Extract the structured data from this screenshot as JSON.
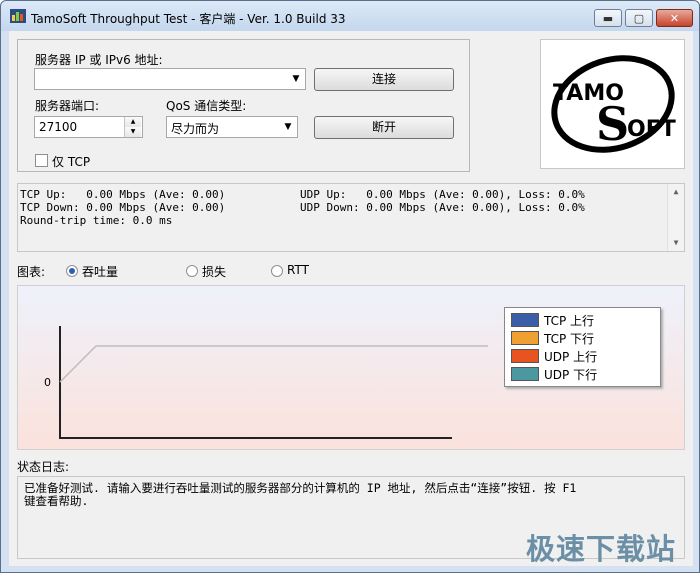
{
  "window": {
    "title": "TamoSoft Throughput Test - 客户端 - Ver. 1.0 Build 33",
    "buttons": {
      "minimize": "▬",
      "maximize": "▢",
      "close": "✕"
    }
  },
  "connection": {
    "server_label": "服务器 IP 或 IPv6 地址:",
    "server_value": "",
    "port_label": "服务器端口:",
    "port_value": "27100",
    "qos_label": "QoS 通信类型:",
    "qos_value": "尽力而为",
    "tcp_only_label": "仅 TCP",
    "connect_button": "连接",
    "disconnect_button": "断开"
  },
  "logo": {
    "text_top": "TAMO",
    "text_bottom": "OFT",
    "letter_s": "S"
  },
  "stats": {
    "tcp_up": "TCP Up:   0.00 Mbps (Ave: 0.00)",
    "tcp_down": "TCP Down: 0.00 Mbps (Ave: 0.00)",
    "udp_up": "UDP Up:   0.00 Mbps (Ave: 0.00), Loss: 0.0%",
    "udp_down": "UDP Down: 0.00 Mbps (Ave: 0.00), Loss: 0.0%",
    "rtt": "Round-trip time: 0.0 ms"
  },
  "chart_selector": {
    "label": "图表:",
    "options": [
      "吞吐量",
      "损失",
      "RTT"
    ],
    "selected": "吞吐量"
  },
  "chart": {
    "y_tick": "0",
    "legend": [
      {
        "label": "TCP 上行",
        "color": "#3a5fa8"
      },
      {
        "label": "TCP 下行",
        "color": "#f0a030"
      },
      {
        "label": "UDP 上行",
        "color": "#e85420"
      },
      {
        "label": "UDP 下行",
        "color": "#4b98a0"
      }
    ]
  },
  "log": {
    "label": "状态日志:",
    "line1": "已准备好测试. 请输入要进行吞吐量测试的服务器部分的计算机的 IP 地址, 然后点击“连接”按钮. 按 F1",
    "line2": "键查看帮助."
  },
  "watermark": "极速下载站"
}
